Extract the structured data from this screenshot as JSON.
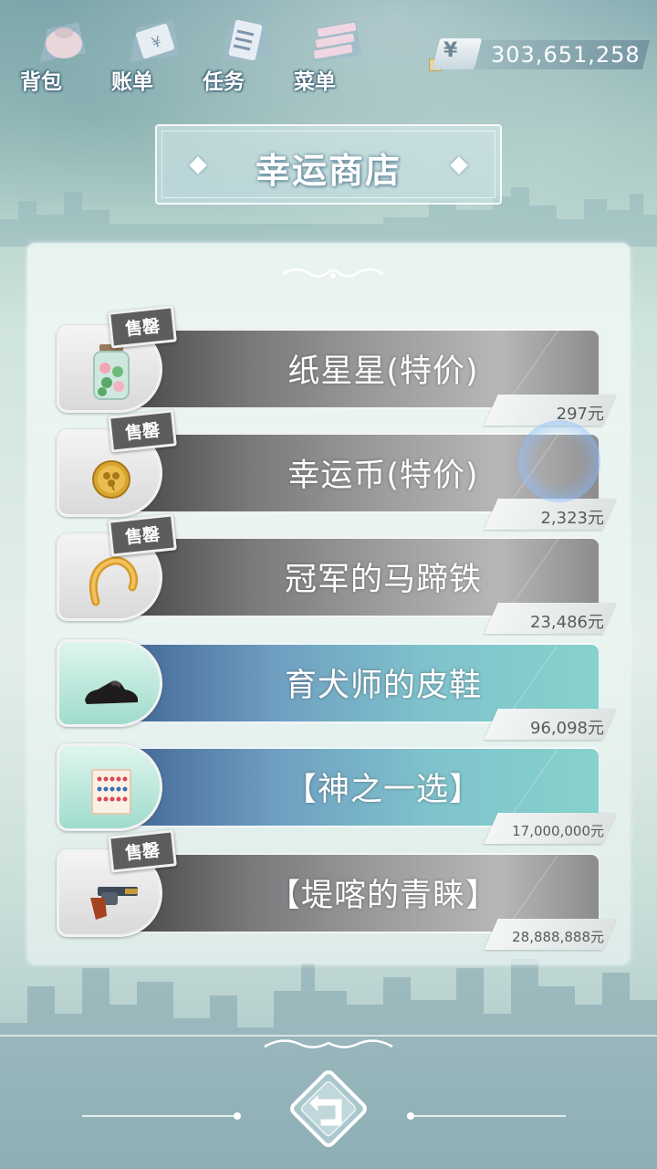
{
  "nav": [
    {
      "label": "背包",
      "icon": "bag-icon"
    },
    {
      "label": "账单",
      "icon": "bill-icon"
    },
    {
      "label": "任务",
      "icon": "task-icon"
    },
    {
      "label": "菜单",
      "icon": "menu-icon"
    }
  ],
  "money": {
    "symbol": "¥",
    "amount": "303,651,258"
  },
  "shop": {
    "title": "幸运商店"
  },
  "items": [
    {
      "name": "纸星星(特价)",
      "price": "297元",
      "sold_out": true,
      "sold_label": "售罄",
      "style": "gray",
      "icon": "paper-star-jar-icon"
    },
    {
      "name": "幸运币(特价)",
      "price": "2,323元",
      "sold_out": true,
      "sold_label": "售罄",
      "style": "gray",
      "icon": "clover-coin-icon"
    },
    {
      "name": "冠军的马蹄铁",
      "price": "23,486元",
      "sold_out": true,
      "sold_label": "售罄",
      "style": "gray",
      "icon": "horseshoe-icon"
    },
    {
      "name": "育犬师的皮鞋",
      "price": "96,098元",
      "sold_out": false,
      "sold_label": "",
      "style": "teal",
      "icon": "leather-shoe-icon"
    },
    {
      "name": "【神之一选】",
      "price": "17,000,000元",
      "sold_out": false,
      "sold_label": "",
      "style": "teal",
      "icon": "lottery-ticket-icon"
    },
    {
      "name": "【堤喀的青睐】",
      "price": "28,888,888元",
      "sold_out": true,
      "sold_label": "售罄",
      "style": "gray",
      "icon": "revolver-icon"
    }
  ],
  "back_button": {
    "icon": "back-arrow-icon"
  }
}
